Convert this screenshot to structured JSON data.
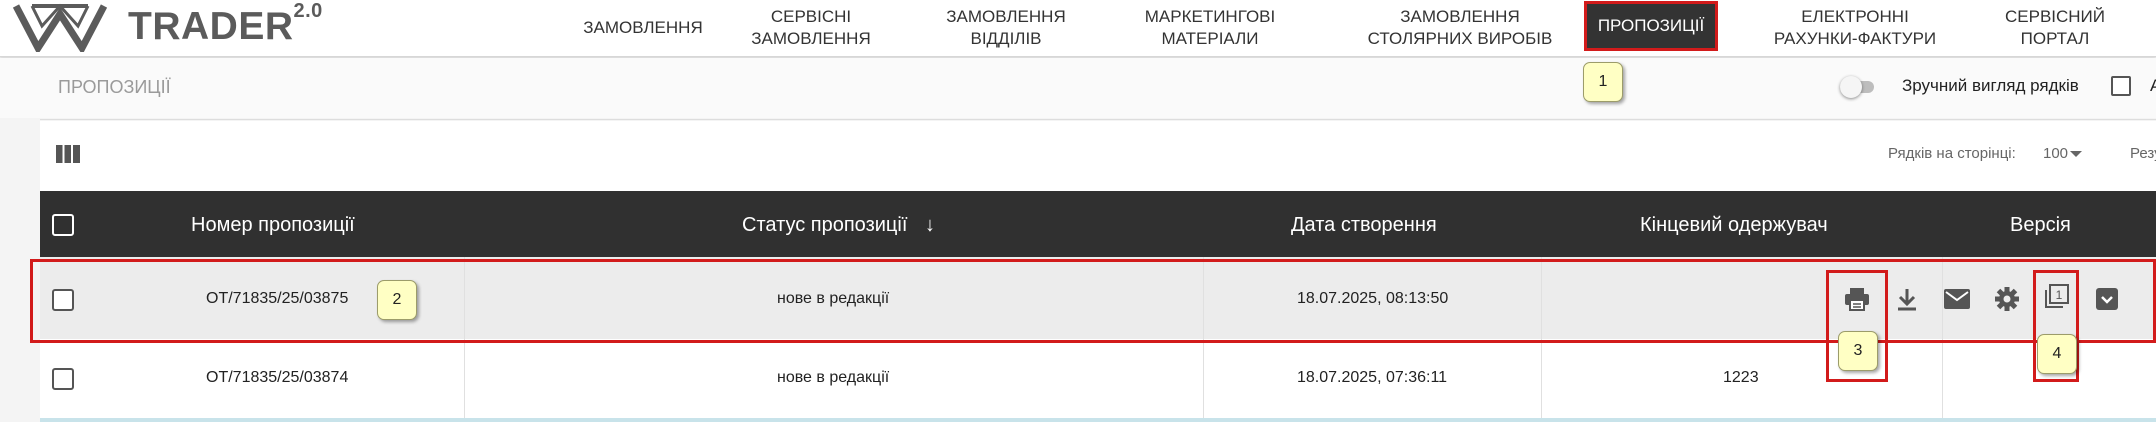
{
  "app": {
    "brand": "TRADER",
    "brand_version": "2.0"
  },
  "nav": [
    {
      "label": "ЗАМОВЛЕННЯ"
    },
    {
      "label": "СЕРВІСНІ\nЗАМОВЛЕННЯ"
    },
    {
      "label": "ЗАМОВЛЕННЯ\nВІДДІЛІВ"
    },
    {
      "label": "МАРКЕТИНГОВІ\nМАТЕРІАЛИ"
    },
    {
      "label": "ЗАМОВЛЕННЯ\nСТОЛЯРНИХ ВИРОБІВ"
    },
    {
      "label": "ПРОПОЗИЦІЇ",
      "active": true
    },
    {
      "label": "ЕЛЕКТРОННІ\nРАХУНКИ-ФАКТУРИ"
    },
    {
      "label": "СЕРВІСНИЙ\nПОРТАЛ"
    }
  ],
  "page": {
    "breadcrumb": "ПРОПОЗИЦІЇ",
    "toggle_label": "Зручний вигляд рядків",
    "toggle_on": false,
    "extra_checkbox_label": "А"
  },
  "pagination": {
    "rows_per_page_label": "Рядків на сторінці:",
    "rows_per_page_value": "100",
    "results_label": "Резу"
  },
  "table": {
    "columns": [
      "Номер пропозиції",
      "Статус пропозиції",
      "Дата створення",
      "Кінцевий одержувач",
      "Версія"
    ],
    "sort_arrow": "↓",
    "rows": [
      {
        "number": "OT/71835/25/03875",
        "status": "нове в редакції",
        "created": "18.07.2025, 08:13:50",
        "recipient": "",
        "version": ""
      },
      {
        "number": "OT/71835/25/03874",
        "status": "нове в редакції",
        "created": "18.07.2025, 07:36:11",
        "recipient": "1223",
        "version": ""
      }
    ]
  },
  "row_actions": [
    "print-icon",
    "download-icon",
    "email-icon",
    "settings-icon",
    "copy-version-icon",
    "archive-icon"
  ],
  "callouts": [
    "1",
    "2",
    "3",
    "4"
  ],
  "colors": {
    "header_bg": "#303030",
    "highlight": "#d21b1b",
    "callout_bg": "#ffffc4",
    "active_nav": "#333333"
  }
}
